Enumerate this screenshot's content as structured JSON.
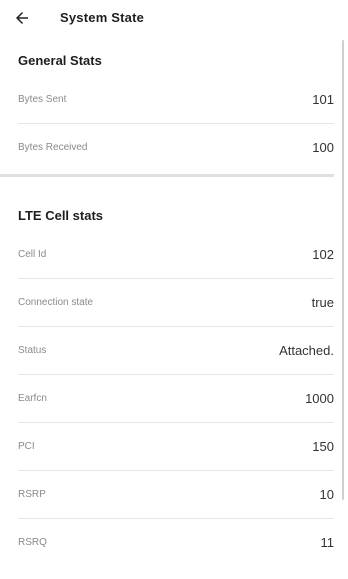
{
  "app_bar": {
    "title": "System State",
    "back_icon": "arrow-left-icon"
  },
  "sections": [
    {
      "title": "General Stats",
      "rows": [
        {
          "label": "Bytes Sent",
          "value": "101"
        },
        {
          "label": "Bytes Received",
          "value": "100"
        }
      ]
    },
    {
      "title": "LTE Cell stats",
      "rows": [
        {
          "label": "Cell Id",
          "value": "102"
        },
        {
          "label": "Connection state",
          "value": "true"
        },
        {
          "label": "Status",
          "value": "Attached."
        },
        {
          "label": "Earfcn",
          "value": "1000"
        },
        {
          "label": "PCI",
          "value": "150"
        },
        {
          "label": "RSRP",
          "value": "10"
        },
        {
          "label": "RSRQ",
          "value": "11"
        }
      ]
    }
  ]
}
